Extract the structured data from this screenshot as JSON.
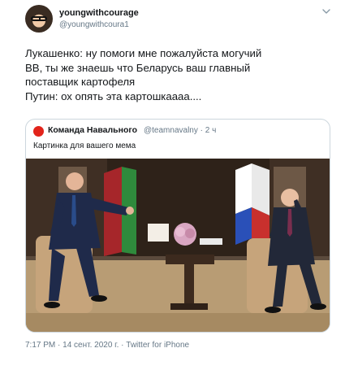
{
  "author": {
    "display_name": "youngwithcourage",
    "handle": "@youngwithcoura1"
  },
  "tweet": {
    "lines": [
      "Лукашенко: ну помоги мне пожалуйста могучий",
      "ВВ, ты же знаешь что Беларусь ваш главный",
      "поставщик картофеля",
      "Путин: ох опять эта картошкаааа...."
    ]
  },
  "quote": {
    "display_name": "Команда Навального",
    "handle_time": "@teamnavalny · 2 ч",
    "text": "Картинка для вашего мема"
  },
  "meta": {
    "time": "7:17 PM",
    "date": "14 сент. 2020 г.",
    "source": "Twitter for iPhone"
  },
  "icons": {
    "more": "chevron-down-icon",
    "quote_avatar": "team-logo-icon"
  },
  "colors": {
    "text": "#14171a",
    "secondary": "#657786",
    "border": "#ccd6dd",
    "quote_avatar": "#e2241b"
  }
}
